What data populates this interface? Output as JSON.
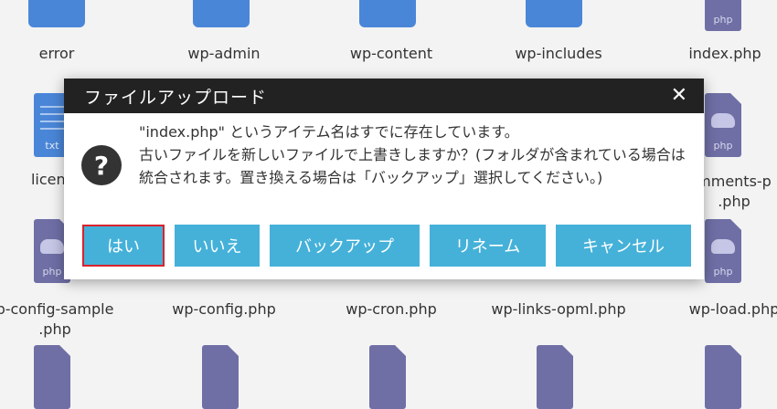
{
  "files": [
    {
      "name": "error",
      "type": "folder"
    },
    {
      "name": "wp-admin",
      "type": "folder"
    },
    {
      "name": "wp-content",
      "type": "folder"
    },
    {
      "name": "wp-includes",
      "type": "folder"
    },
    {
      "name": "index.php",
      "type": "php",
      "ext": "php"
    },
    {
      "name": "licens",
      "type": "txt",
      "ext": "txt"
    },
    {
      "name": "mments-p",
      "name2": ".php",
      "type": "php",
      "ext": "php"
    },
    {
      "name": "p-config-sample",
      "name2": ".php",
      "type": "php",
      "ext": "php"
    },
    {
      "name": "wp-config.php",
      "type": "php"
    },
    {
      "name": "wp-cron.php",
      "type": "php"
    },
    {
      "name": "wp-links-opml.php",
      "type": "php"
    },
    {
      "name": "wp-load.php",
      "type": "php",
      "ext": "php"
    }
  ],
  "dialog": {
    "title": "ファイルアップロード",
    "close_glyph": "✕",
    "question_glyph": "?",
    "message_line1": "\"index.php\" というアイテム名はすでに存在しています。",
    "message_line2": "古いファイルを新しいファイルで上書きしますか？(フォルダが含まれている場合は統合されます。置き換える場合は「バックアップ」選択してください。)",
    "buttons": {
      "yes": "はい",
      "no": "いいえ",
      "backup": "バックアップ",
      "rename": "リネーム",
      "cancel": "キャンセル"
    }
  },
  "colors": {
    "titlebar": "#222222",
    "button": "#45b1d9",
    "selected_outline": "#d9232c",
    "folder": "#4a86d8",
    "php_file": "#6f6fa6"
  }
}
